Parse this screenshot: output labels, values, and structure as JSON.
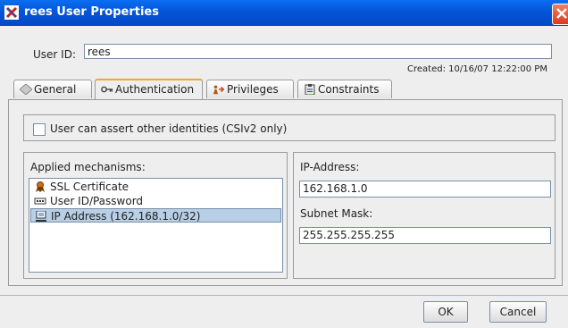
{
  "window": {
    "title": "rees User Properties"
  },
  "user": {
    "label": "User ID:",
    "value": "rees",
    "created": "Created: 10/16/07 12:22:00 PM"
  },
  "tabs": [
    {
      "label": "General",
      "icon": "diamond-icon"
    },
    {
      "label": "Authentication",
      "icon": "key-icon"
    },
    {
      "label": "Privileges",
      "icon": "person-arrow-icon"
    },
    {
      "label": "Constraints",
      "icon": "clipboard-icon"
    }
  ],
  "auth": {
    "assert_label": "User can assert other identities (CSIv2 only)",
    "mechanisms_title": "Applied mechanisms:",
    "mechanisms": [
      {
        "label": "SSL Certificate",
        "icon": "certificate-icon"
      },
      {
        "label": "User ID/Password",
        "icon": "password-icon"
      },
      {
        "label": "IP Address (162.168.1.0/32)",
        "icon": "computer-icon"
      }
    ],
    "ip_label": "IP-Address:",
    "ip_value": "162.168.1.0",
    "mask_label": "Subnet Mask:",
    "mask_value": "255.255.255.255"
  },
  "buttons": {
    "ok": "OK",
    "cancel": "Cancel"
  },
  "colors": {
    "titlebar": "#0454d6",
    "selected_row": "#b8cfe5",
    "active_tab_accent": "#f0a72a"
  }
}
